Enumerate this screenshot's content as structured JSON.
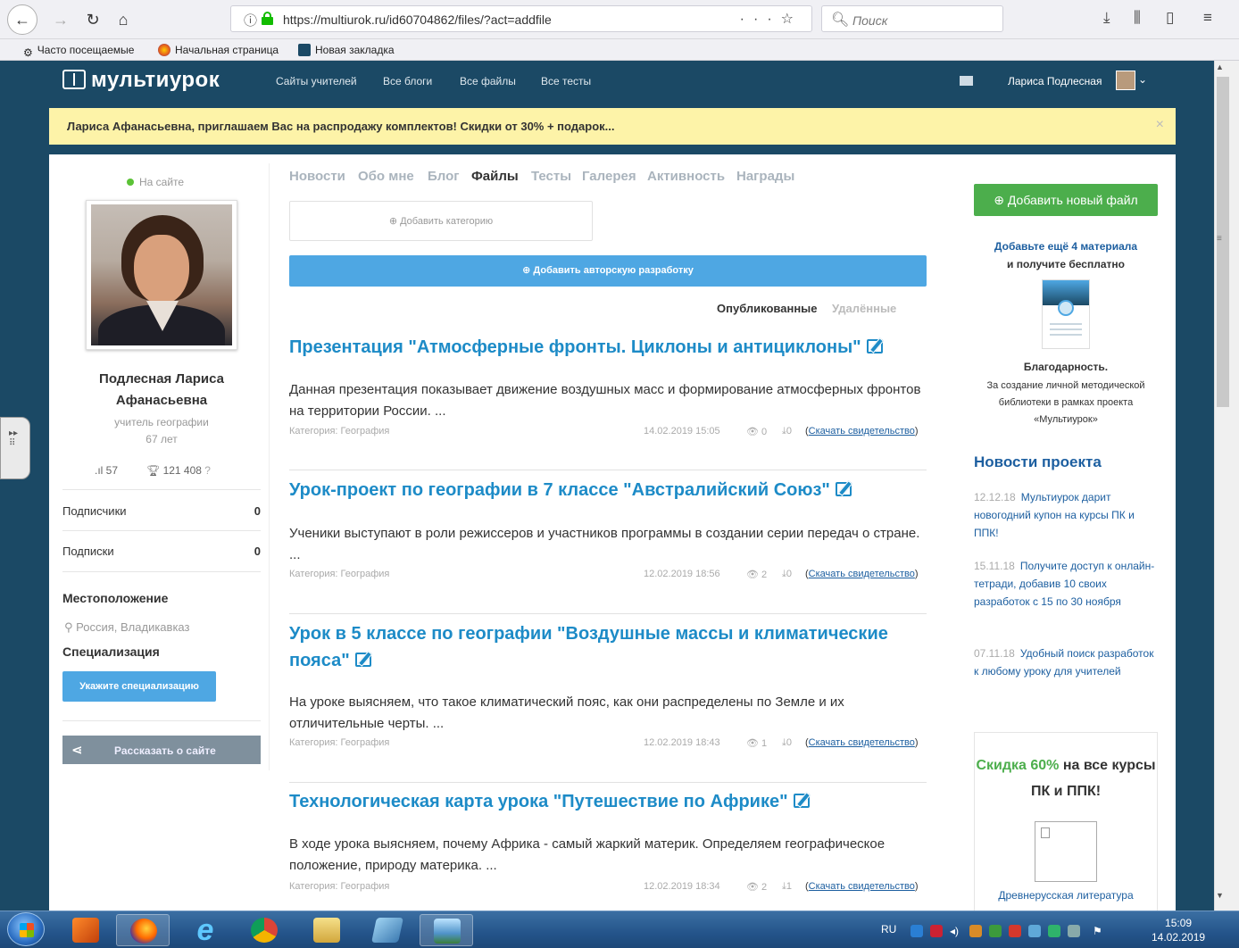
{
  "browser": {
    "url": "https://multiurok.ru/id60704862/files/?act=addfile",
    "search_placeholder": "Поиск",
    "bookmarks": [
      "Часто посещаемые",
      "Начальная страница",
      "Новая закладка"
    ]
  },
  "site": {
    "logo": "мультиурок",
    "nav": [
      "Сайты учителей",
      "Все блоги",
      "Все файлы",
      "Все тесты"
    ],
    "user_name": "Лариса Подлесная"
  },
  "promo_banner": {
    "text": "Лариса Афанасьевна, приглашаем Вас на распродажу комплектов! Скидки от 30% + подарок...",
    "close": "×"
  },
  "profile": {
    "status": "На сайте",
    "name": "Подлесная Лариса Афанасьевна",
    "role": "учитель географии",
    "age": "67 лет",
    "stat_materials": "57",
    "stat_points": "121 408",
    "subscribers_label": "Подписчики",
    "subscribers_value": "0",
    "subscriptions_label": "Подписки",
    "subscriptions_value": "0",
    "location_heading": "Местоположение",
    "location_value": "Россия, Владикавказ",
    "specialization_heading": "Специализация",
    "specialization_button": "Укажите специализацию",
    "share_button": "Рассказать о сайте"
  },
  "tabs": [
    "Новости",
    "Обо мне",
    "Блог",
    "Файлы",
    "Тесты",
    "Галерея",
    "Активность",
    "Награды"
  ],
  "active_tab": "Файлы",
  "main": {
    "add_category": "Добавить категорию",
    "add_development": "Добавить авторскую разработку",
    "filter_published": "Опубликованные",
    "filter_deleted": "Удалённые",
    "articles": [
      {
        "title": "Презентация \"Атмосферные фронты. Циклоны и антициклоны\"",
        "desc": "Данная презентация показывает движение воздушных масс и формирование атмосферных фронтов на территории России. ...",
        "category": "Категория: География",
        "date": "14.02.2019 15:05",
        "views": "0",
        "downloads": "0",
        "cert": "Скачать свидетельство"
      },
      {
        "title": "Урок-проект по географии в 7 классе \"Австралийский Союз\"",
        "desc": "Ученики выступают в роли режиссеров и участников программы в создании серии передач о стране. ...",
        "category": "Категория: География",
        "date": "12.02.2019 18:56",
        "views": "2",
        "downloads": "0",
        "cert": "Скачать свидетельство"
      },
      {
        "title": "Урок в 5 классе по географии \"Воздушные массы и климатические пояса\"",
        "desc": "На уроке выясняем, что такое климатический пояс, как они распределены по Земле и их отличительные черты. ...",
        "category": "Категория: География",
        "date": "12.02.2019 18:43",
        "views": "1",
        "downloads": "0",
        "cert": "Скачать свидетельство"
      },
      {
        "title": "Технологическая карта урока \"Путешествие по Африке\"",
        "desc": "В ходе урока выясняем, почему Африка - самый жаркий материк. Определяем географическое положение, природу материка. ...",
        "category": "Категория: География",
        "date": "12.02.2019 18:34",
        "views": "2",
        "downloads": "1",
        "cert": "Скачать свидетельство"
      }
    ]
  },
  "sidebar": {
    "add_file": "Добавить новый файл",
    "promo_line1": "Добавьте ещё 4 материала",
    "promo_line2": "и получите бесплатно",
    "cert_heading": "Благодарность.",
    "cert_desc": "За создание личной методической библиотеки в рамках проекта «Мультиурок»",
    "news_heading": "Новости проекта",
    "news": [
      {
        "date": "12.12.18",
        "text": "Мультиурок дарит новогодний купон на курсы ПК и ППК!"
      },
      {
        "date": "15.11.18",
        "text": "Получите доступ к онлайн-тетради, добавив 10 своих разработок с 15 по 30 ноября"
      },
      {
        "date": "07.11.18",
        "text": "Удобный поиск разработок к любому уроку для учителей"
      }
    ],
    "ad_discount": "Скидка 60%",
    "ad_rest": "на все курсы ПК и ППК!",
    "ad_caption": "Древнерусская литература"
  },
  "taskbar": {
    "lang": "RU",
    "time": "15:09",
    "date": "14.02.2019"
  },
  "colors": {
    "brand_dark": "#1b4965",
    "link_blue": "#1d8bc7",
    "button_blue": "#4ea7e3",
    "button_green": "#4cae4c",
    "promo_yellow": "#fdf3a8"
  }
}
